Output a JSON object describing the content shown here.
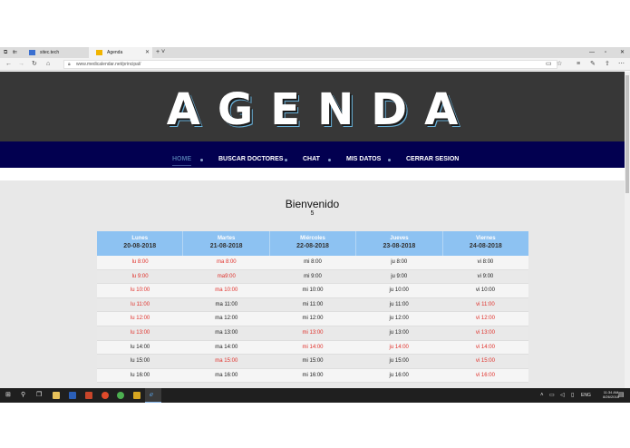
{
  "browser": {
    "tabs": [
      {
        "label": "sitec.tech"
      },
      {
        "label": "Agenda"
      }
    ],
    "url": "www.medicalendar.net/principal/"
  },
  "site": {
    "title": "AGENDA",
    "nav": [
      {
        "label": "HOME"
      },
      {
        "label": "BUSCAR DOCTORES"
      },
      {
        "label": "CHAT"
      },
      {
        "label": "MIS DATOS"
      },
      {
        "label": "CERRAR SESION"
      }
    ],
    "welcome": "Bienvenido",
    "welcome_number": "5"
  },
  "schedule": {
    "days": [
      {
        "name": "Lunes",
        "date": "20-08-2018"
      },
      {
        "name": "Martes",
        "date": "21-08-2018"
      },
      {
        "name": "Miércoles",
        "date": "22-08-2018"
      },
      {
        "name": "Jueves",
        "date": "23-08-2018"
      },
      {
        "name": "Viernes",
        "date": "24-08-2018"
      }
    ],
    "rows": [
      [
        {
          "t": "lu 8:00",
          "busy": true
        },
        {
          "t": "ma 8:00",
          "busy": true
        },
        {
          "t": "mi 8:00",
          "busy": false
        },
        {
          "t": "ju 8:00",
          "busy": false
        },
        {
          "t": "vi 8:00",
          "busy": false
        }
      ],
      [
        {
          "t": "lu 9:00",
          "busy": true
        },
        {
          "t": "ma9:00",
          "busy": true
        },
        {
          "t": "mi 9:00",
          "busy": false
        },
        {
          "t": "ju 9:00",
          "busy": false
        },
        {
          "t": "vi 9:00",
          "busy": false
        }
      ],
      [
        {
          "t": "lu 10:00",
          "busy": true
        },
        {
          "t": "ma 10:00",
          "busy": true
        },
        {
          "t": "mi 10:00",
          "busy": false
        },
        {
          "t": "ju 10:00",
          "busy": false
        },
        {
          "t": "vi 10:00",
          "busy": false
        }
      ],
      [
        {
          "t": "lu 11:00",
          "busy": true
        },
        {
          "t": "ma 11:00",
          "busy": false
        },
        {
          "t": "mi 11:00",
          "busy": false
        },
        {
          "t": "ju 11:00",
          "busy": false
        },
        {
          "t": "vi 11:00",
          "busy": true
        }
      ],
      [
        {
          "t": "lu 12:00",
          "busy": true
        },
        {
          "t": "ma 12:00",
          "busy": false
        },
        {
          "t": "mi 12:00",
          "busy": false
        },
        {
          "t": "ju 12:00",
          "busy": false
        },
        {
          "t": "vi 12:00",
          "busy": true
        }
      ],
      [
        {
          "t": "lu 13:00",
          "busy": true
        },
        {
          "t": "ma 13:00",
          "busy": false
        },
        {
          "t": "mi 13:00",
          "busy": true
        },
        {
          "t": "ju 13:00",
          "busy": false
        },
        {
          "t": "vi 13:00",
          "busy": true
        }
      ],
      [
        {
          "t": "lu 14:00",
          "busy": false
        },
        {
          "t": "ma 14:00",
          "busy": false
        },
        {
          "t": "mi 14:00",
          "busy": true
        },
        {
          "t": "ju 14:00",
          "busy": true
        },
        {
          "t": "vi 14:00",
          "busy": true
        }
      ],
      [
        {
          "t": "lu 15:00",
          "busy": false
        },
        {
          "t": "ma 15:00",
          "busy": true
        },
        {
          "t": "mi 15:00",
          "busy": false
        },
        {
          "t": "ju 15:00",
          "busy": false
        },
        {
          "t": "vi 15:00",
          "busy": true
        }
      ],
      [
        {
          "t": "lu 16:00",
          "busy": false
        },
        {
          "t": "ma 16:00",
          "busy": false
        },
        {
          "t": "mi 16:00",
          "busy": false
        },
        {
          "t": "ju 16:00",
          "busy": false
        },
        {
          "t": "vi 16:00",
          "busy": true
        }
      ]
    ]
  },
  "taskbar": {
    "lang": "ENG",
    "time": "11:34 AM",
    "date": "8/26/2018"
  },
  "colors": {
    "hero_bg": "#373737",
    "navbar_bg": "#020050",
    "header_blue": "#8dc2f2",
    "busy_red": "#e0302a"
  }
}
